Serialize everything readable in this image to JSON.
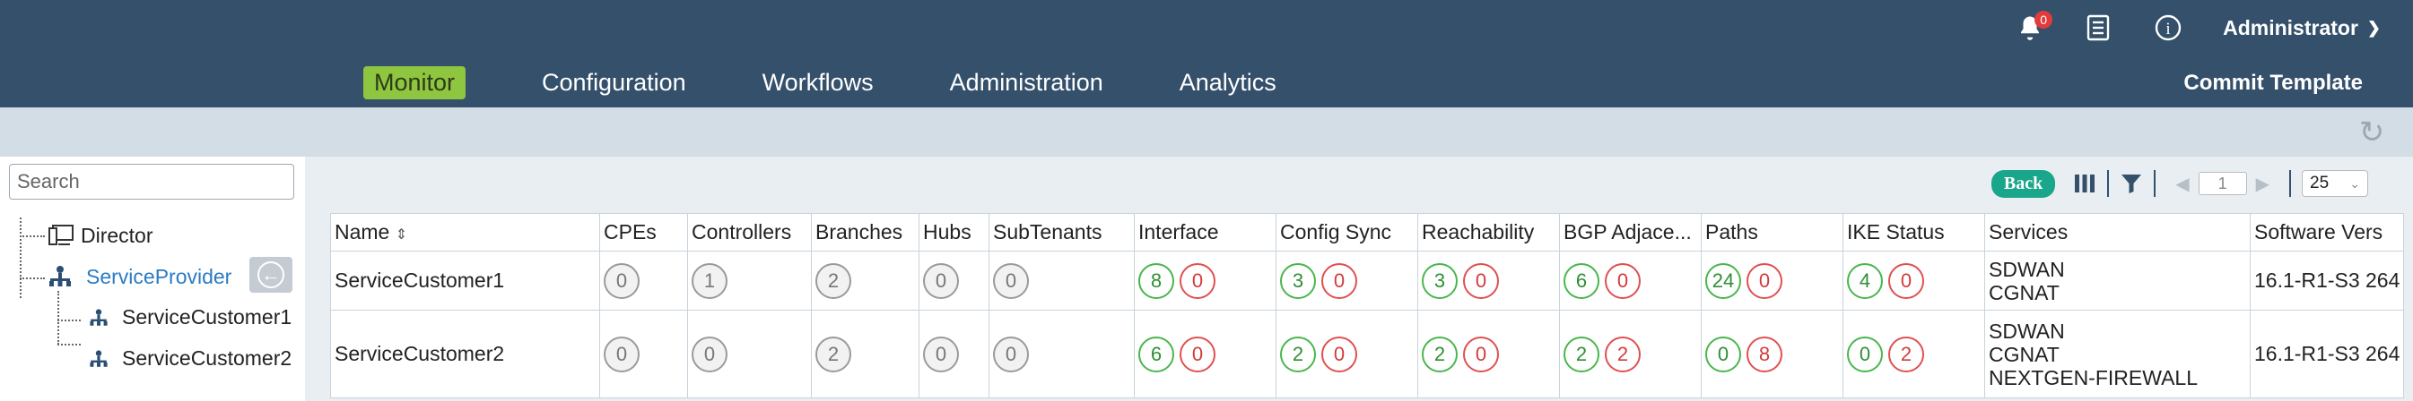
{
  "header": {
    "nav": [
      "Monitor",
      "Configuration",
      "Workflows",
      "Administration",
      "Analytics"
    ],
    "active_nav": "Monitor",
    "commit_label": "Commit Template",
    "notification_count": "0",
    "user": "Administrator",
    "colors": {
      "header_bg": "#34506b",
      "active_tab": "#8ec640"
    }
  },
  "sidebar": {
    "search_placeholder": "Search",
    "tree": [
      {
        "label": "Director",
        "icon": "director-icon"
      },
      {
        "label": "ServiceProvider",
        "icon": "org-icon"
      },
      {
        "label": "ServiceCustomer1",
        "icon": "org-icon"
      },
      {
        "label": "ServiceCustomer2",
        "icon": "org-icon"
      }
    ]
  },
  "toolbar": {
    "back_label": "Back",
    "page": "1",
    "per_page": "25"
  },
  "table": {
    "columns": [
      "Name",
      "CPEs",
      "Controllers",
      "Branches",
      "Hubs",
      "SubTenants",
      "Interface",
      "Config Sync",
      "Reachability",
      "BGP Adjace...",
      "Paths",
      "IKE Status",
      "Services",
      "Software Vers"
    ],
    "rows": [
      {
        "name": "ServiceCustomer1",
        "cpes": "0",
        "controllers": "1",
        "branches": "2",
        "hubs": "0",
        "subtenants": "0",
        "interface": [
          "8",
          "0"
        ],
        "config_sync": [
          "3",
          "0"
        ],
        "reachability": [
          "3",
          "0"
        ],
        "bgp": [
          "6",
          "0"
        ],
        "paths": [
          "24",
          "0"
        ],
        "ike": [
          "4",
          "0"
        ],
        "services": [
          "SDWAN",
          "CGNAT"
        ],
        "software": "16.1-R1-S3 264"
      },
      {
        "name": "ServiceCustomer2",
        "cpes": "0",
        "controllers": "0",
        "branches": "2",
        "hubs": "0",
        "subtenants": "0",
        "interface": [
          "6",
          "0"
        ],
        "config_sync": [
          "2",
          "0"
        ],
        "reachability": [
          "2",
          "0"
        ],
        "bgp": [
          "2",
          "2"
        ],
        "paths": [
          "0",
          "8"
        ],
        "ike": [
          "0",
          "2"
        ],
        "services": [
          "SDWAN",
          "CGNAT",
          "NEXTGEN-FIREWALL"
        ],
        "software": "16.1-R1-S3 264"
      }
    ]
  }
}
